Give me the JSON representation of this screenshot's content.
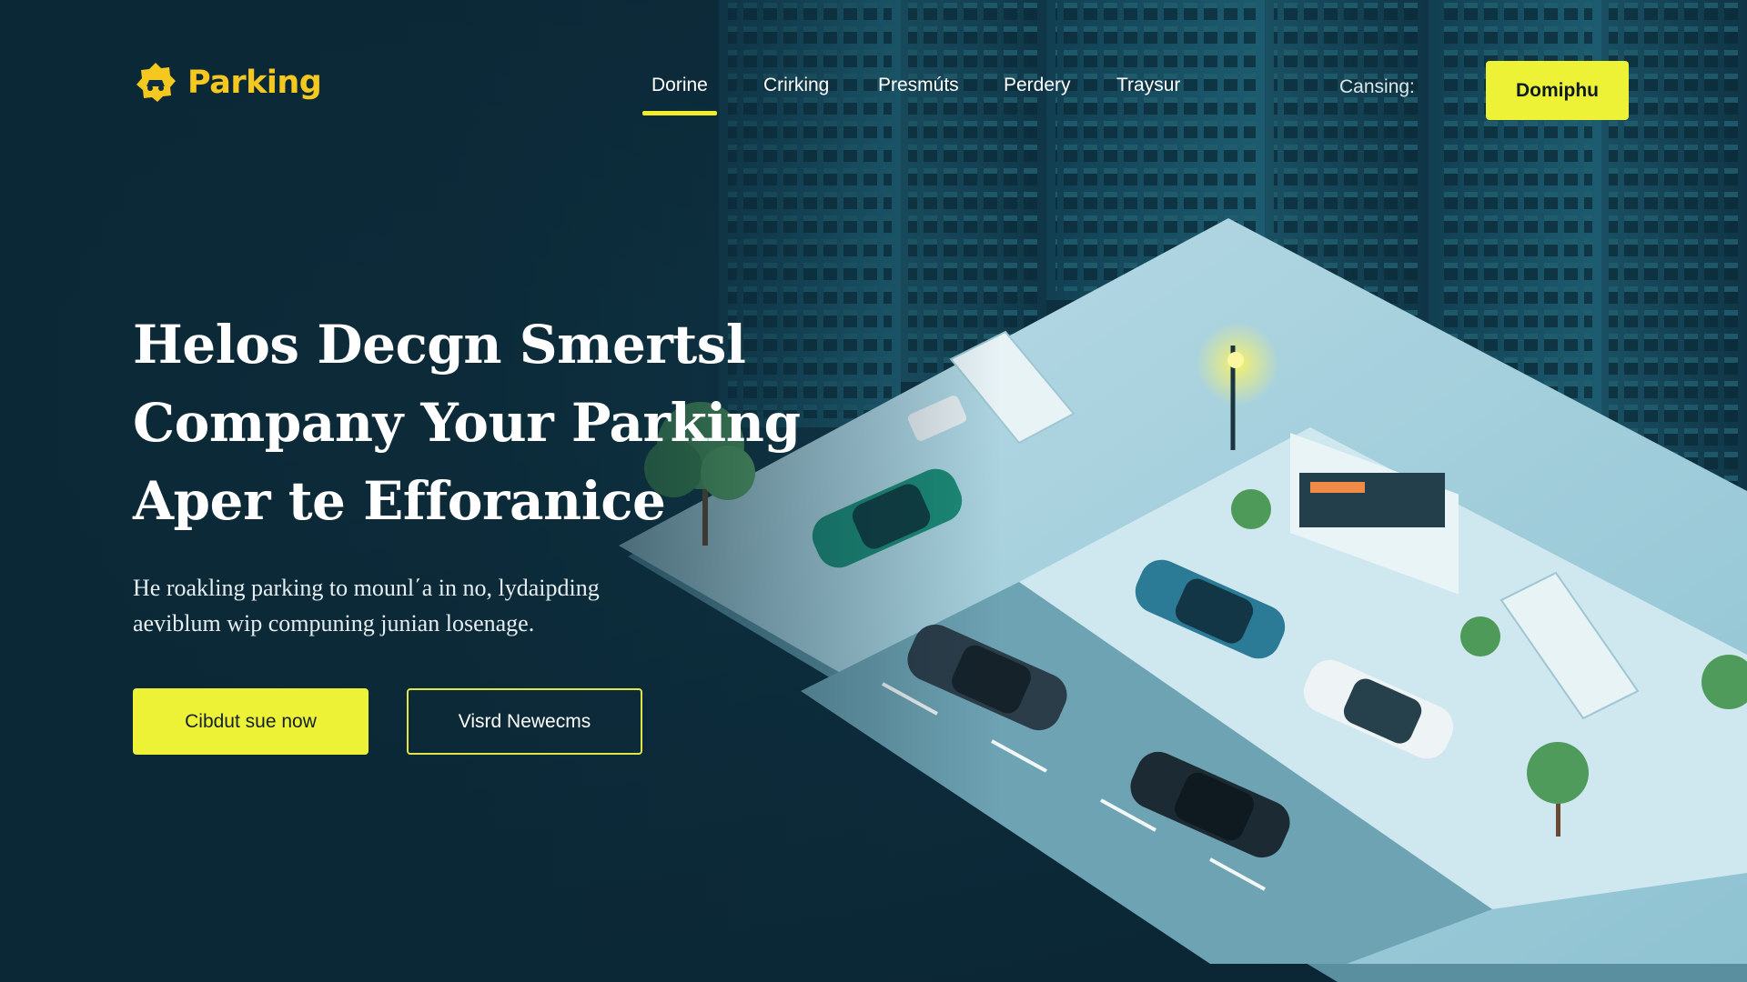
{
  "brand": {
    "name": "Parking",
    "logo_icon": "car-badge-icon",
    "color": "#f4c81f"
  },
  "nav": {
    "items": [
      {
        "label": "Dorine",
        "active": true
      },
      {
        "label": "Crirking",
        "active": false
      },
      {
        "label": "Presmúts",
        "active": false
      },
      {
        "label": "Perdery",
        "active": false
      },
      {
        "label": "Traysur",
        "active": false
      }
    ],
    "contact_label": "Cansing:",
    "cta_label": "Domiphu"
  },
  "hero": {
    "headline": [
      "Helos Decgn Smertsl",
      "Company Your Parking",
      "Aper te Efforanice"
    ],
    "subtext": [
      "He roakling parking to mounl΄a in no, lydaipding",
      "aeviblum wip compuning junian losenage."
    ],
    "primary_button": "Cibdut sue now",
    "secondary_button": "Visrd Newecms"
  },
  "colors": {
    "accent": "#eef236",
    "background": "#0d2e3e",
    "text": "#ffffff"
  },
  "illustration": {
    "subject": "isometric smart parking lot with cars, trees and skyscrapers"
  }
}
